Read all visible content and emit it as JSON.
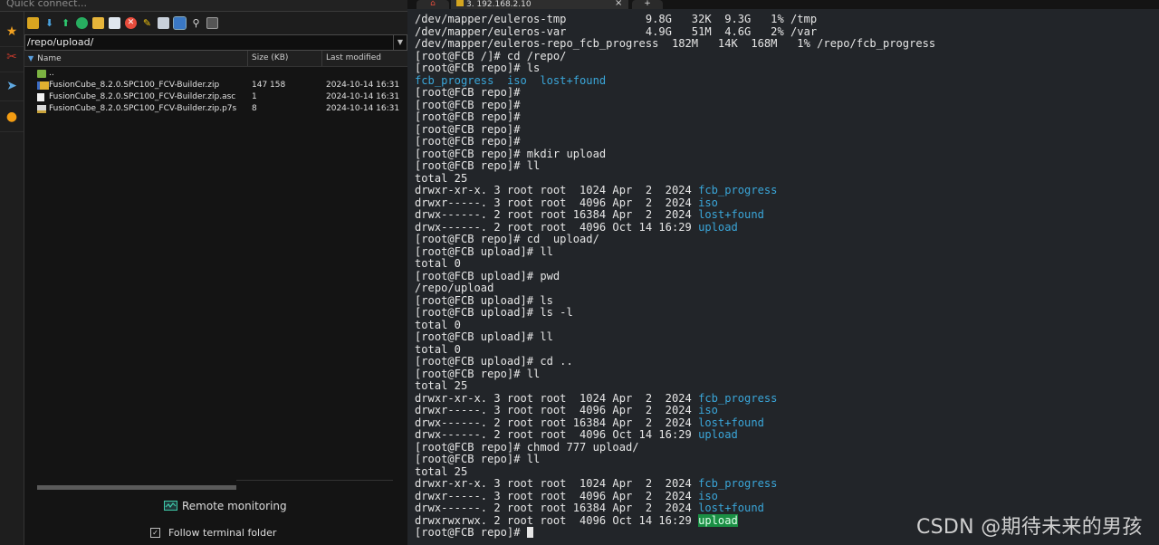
{
  "quick_connect": {
    "placeholder": "Quick connect..."
  },
  "sidebar": {
    "items": [
      {
        "icon": "star-icon",
        "glyph": "★",
        "color": "#f0a020"
      },
      {
        "icon": "tools-icon",
        "glyph": "✂",
        "color": "#c0392b"
      },
      {
        "icon": "send-icon",
        "glyph": "➤",
        "color": "#5fa8e0"
      },
      {
        "icon": "mobaxterm-icon",
        "glyph": "●",
        "color": "#f39c12"
      }
    ]
  },
  "file_browser": {
    "path": "/repo/upload/",
    "columns": {
      "name": "Name",
      "size": "Size (KB)",
      "modified": "Last modified"
    },
    "rows": [
      {
        "name": "..",
        "size": "",
        "modified": "",
        "icon": "parent-folder-icon"
      },
      {
        "name": "FusionCube_8.2.0.SPC100_FCV-Builder.zip",
        "size": "147 158",
        "modified": "2024-10-14 16:31",
        "icon": "zip-file-icon"
      },
      {
        "name": "FusionCube_8.2.0.SPC100_FCV-Builder.zip.asc",
        "size": "1",
        "modified": "2024-10-14 16:31",
        "icon": "text-file-icon"
      },
      {
        "name": "FusionCube_8.2.0.SPC100_FCV-Builder.zip.p7s",
        "size": "8",
        "modified": "2024-10-14 16:31",
        "icon": "cert-file-icon"
      }
    ],
    "remote_monitoring_label": "Remote monitoring",
    "follow_terminal_label": "Follow terminal folder",
    "follow_terminal_checked": "✓"
  },
  "tabs": {
    "home_icon": "home-icon",
    "session_label": "3. 192.168.2.10",
    "close": "×",
    "new_tab": "+"
  },
  "terminal": {
    "lines": [
      {
        "text": "/dev/mapper/euleros-tmp            9.8G   32K  9.3G   1% /tmp"
      },
      {
        "text": "/dev/mapper/euleros-var            4.9G   51M  4.6G   2% /var"
      },
      {
        "text": "/dev/mapper/euleros-repo_fcb_progress  182M   14K  168M   1% /repo/fcb_progress"
      },
      {
        "text": "[root@FCB /]# cd /repo/"
      },
      {
        "text": "[root@FCB repo]# ls"
      },
      {
        "dirs_line": [
          "fcb_progress",
          "iso",
          "lost+found"
        ]
      },
      {
        "text": "[root@FCB repo]#"
      },
      {
        "text": "[root@FCB repo]#"
      },
      {
        "text": "[root@FCB repo]#"
      },
      {
        "text": "[root@FCB repo]#"
      },
      {
        "text": "[root@FCB repo]#"
      },
      {
        "text": "[root@FCB repo]# mkdir upload"
      },
      {
        "text": "[root@FCB repo]# ll"
      },
      {
        "text": "total 25"
      },
      {
        "text": "drwxr-xr-x. 3 root root  1024 Apr  2  2024 ",
        "dir": "fcb_progress"
      },
      {
        "text": "drwxr-----. 3 root root  4096 Apr  2  2024 ",
        "dir": "iso"
      },
      {
        "text": "drwx------. 2 root root 16384 Apr  2  2024 ",
        "dir": "lost+found"
      },
      {
        "text": "drwx------. 2 root root  4096 Oct 14 16:29 ",
        "dir": "upload"
      },
      {
        "text": "[root@FCB repo]# cd  upload/"
      },
      {
        "text": "[root@FCB upload]# ll"
      },
      {
        "text": "total 0"
      },
      {
        "text": "[root@FCB upload]# pwd"
      },
      {
        "text": "/repo/upload"
      },
      {
        "text": "[root@FCB upload]# ls"
      },
      {
        "text": "[root@FCB upload]# ls -l"
      },
      {
        "text": "total 0"
      },
      {
        "text": "[root@FCB upload]# ll"
      },
      {
        "text": "total 0"
      },
      {
        "text": "[root@FCB upload]# cd .."
      },
      {
        "text": "[root@FCB repo]# ll"
      },
      {
        "text": "total 25"
      },
      {
        "text": "drwxr-xr-x. 3 root root  1024 Apr  2  2024 ",
        "dir": "fcb_progress"
      },
      {
        "text": "drwxr-----. 3 root root  4096 Apr  2  2024 ",
        "dir": "iso"
      },
      {
        "text": "drwx------. 2 root root 16384 Apr  2  2024 ",
        "dir": "lost+found"
      },
      {
        "text": "drwx------. 2 root root  4096 Oct 14 16:29 ",
        "dir": "upload"
      },
      {
        "text": "[root@FCB repo]# chmod 777 upload/"
      },
      {
        "text": "[root@FCB repo]# ll"
      },
      {
        "text": "total 25"
      },
      {
        "text": "drwxr-xr-x. 3 root root  1024 Apr  2  2024 ",
        "dir": "fcb_progress"
      },
      {
        "text": "drwxr-----. 3 root root  4096 Apr  2  2024 ",
        "dir": "iso"
      },
      {
        "text": "drwx------. 2 root root 16384 Apr  2  2024 ",
        "dir": "lost+found"
      },
      {
        "text": "drwxrwxrwx. 2 root root  4096 Oct 14 16:29 ",
        "dir": "upload",
        "highlight": true
      },
      {
        "text": "[root@FCB repo]# ",
        "cursor": true
      }
    ]
  },
  "watermark": "CSDN @期待未来的男孩",
  "colors": {
    "dir": "#3aa6d9",
    "highlight_bg": "#1a8f44",
    "terminal_bg": "#222529"
  }
}
